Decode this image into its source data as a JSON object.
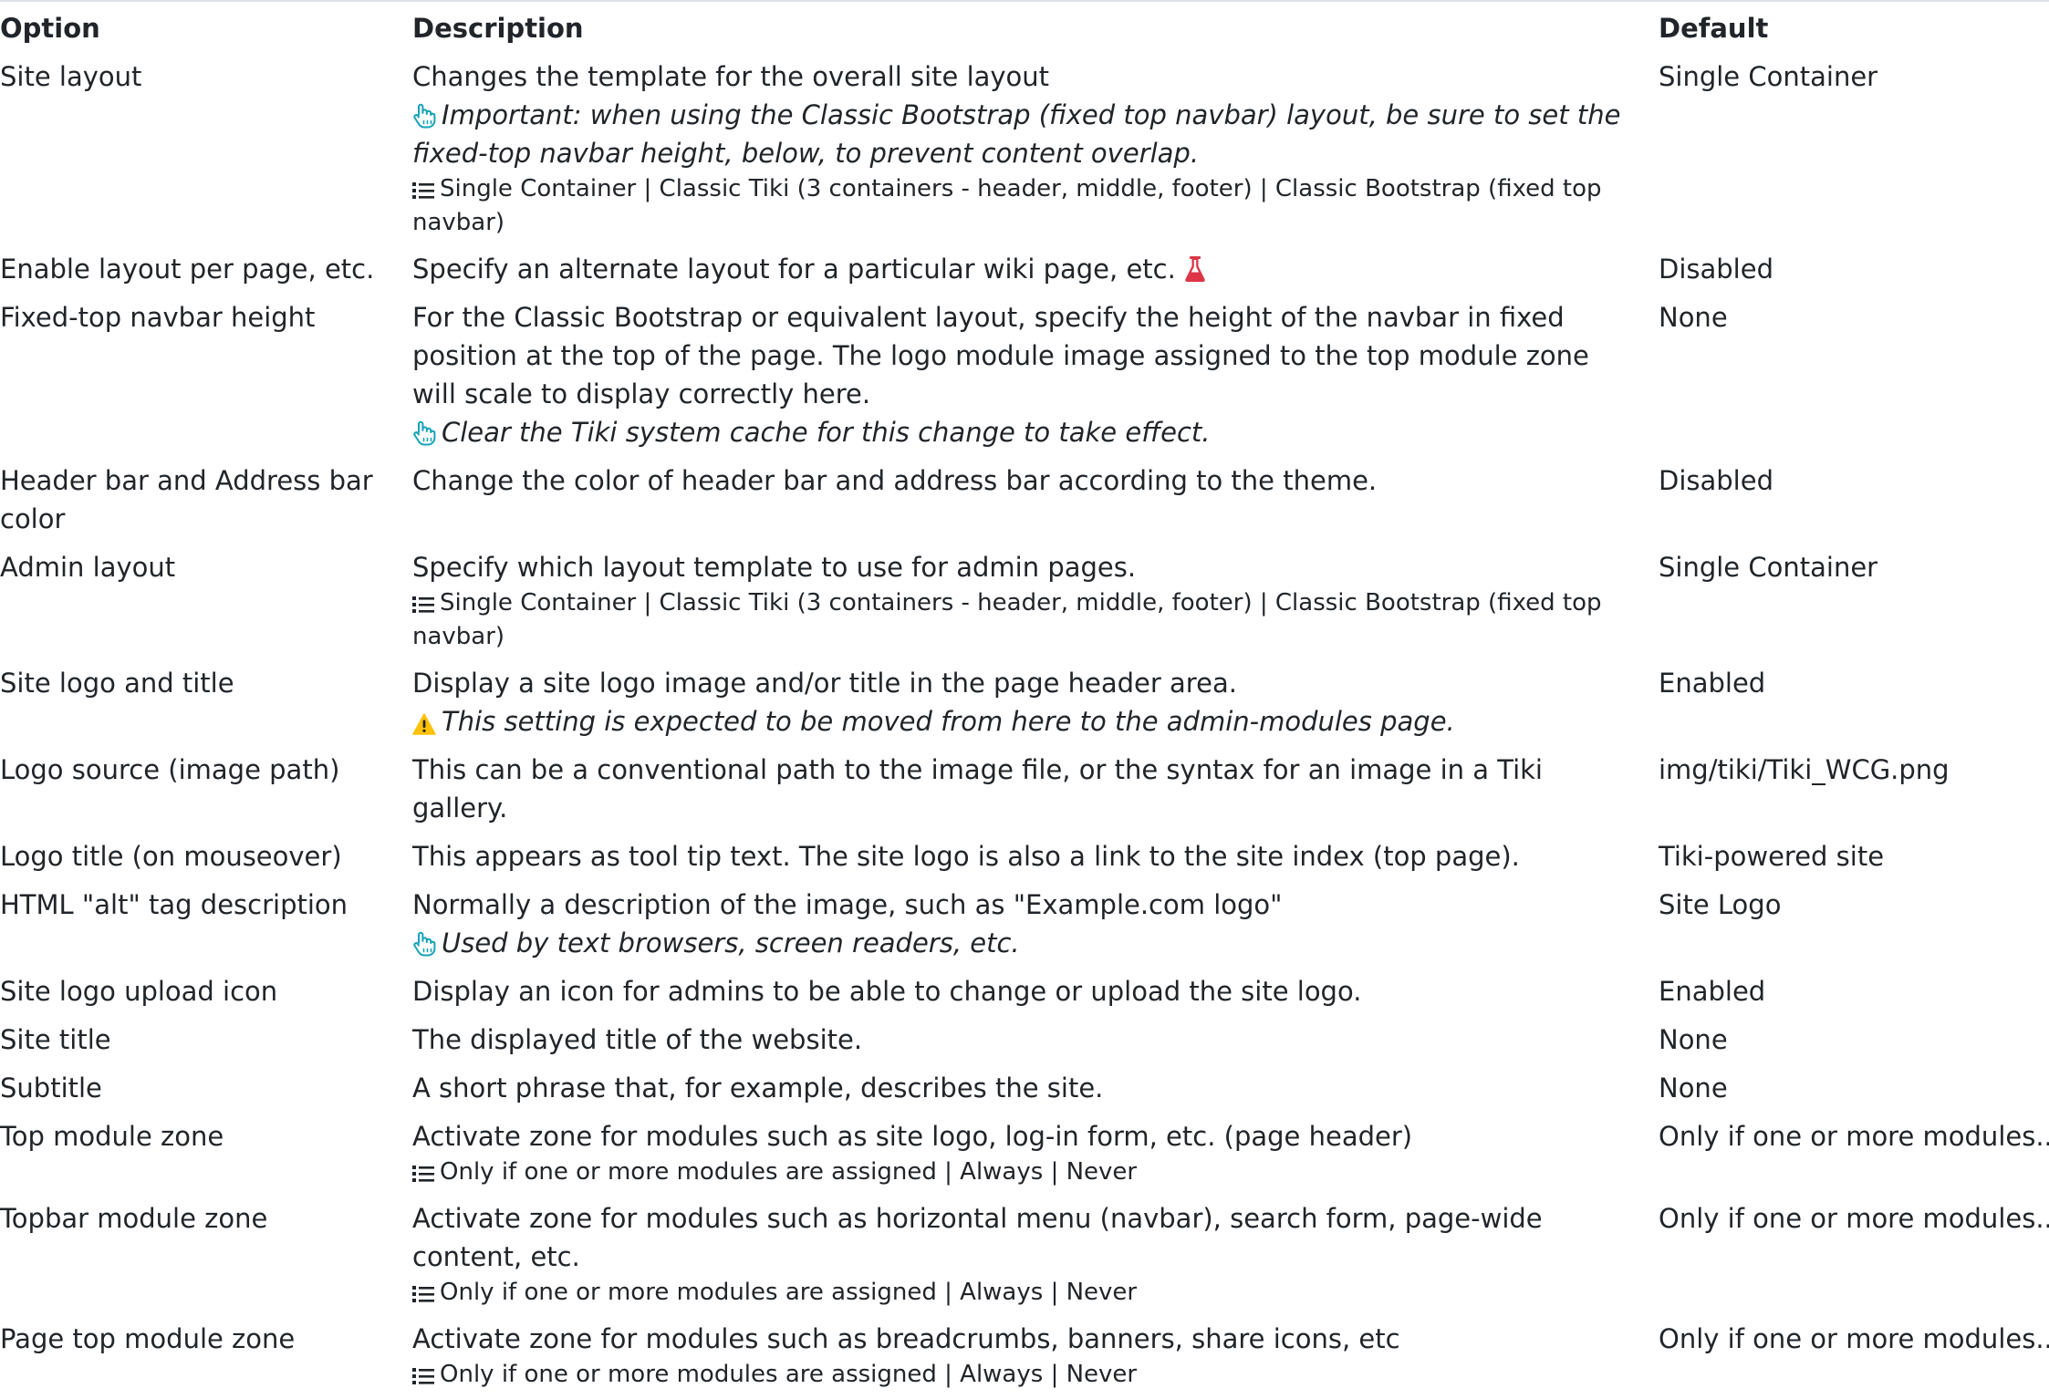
{
  "headers": {
    "option": "Option",
    "description": "Description",
    "default": "Default"
  },
  "icons": {
    "hint": "pointing-hand-icon",
    "list": "list-icon",
    "experimental": "flask-icon",
    "warning": "warning-icon"
  },
  "colors": {
    "hint_icon": "#17a2b8",
    "experimental_icon": "#dc3545",
    "warning_icon": "#ffc107",
    "text": "#212529"
  },
  "rows": [
    {
      "option": "Site layout",
      "description": "Changes the template for the overall site layout",
      "hint": "Important: when using the Classic Bootstrap (fixed top navbar) layout, be sure to set the fixed-top navbar height, below, to prevent content overlap.",
      "options": "Single Container | Classic Tiki (3 containers - header, middle, footer) | Classic Bootstrap (fixed top navbar)",
      "default": "Single Container"
    },
    {
      "option": "Enable layout per page, etc.",
      "description": "Specify an alternate layout for a particular wiki page, etc.",
      "default": "Disabled"
    },
    {
      "option": "Fixed-top navbar height",
      "description": "For the Classic Bootstrap or equivalent layout, specify the height of the navbar in fixed position at the top of the page. The logo module image assigned to the top module zone will scale to display correctly here.",
      "hint": "Clear the Tiki system cache for this change to take effect.",
      "default": "None"
    },
    {
      "option": "Header bar and Address bar color",
      "description": "Change the color of header bar and address bar according to the theme.",
      "default": "Disabled"
    },
    {
      "option": "Admin layout",
      "description": "Specify which layout template to use for admin pages.",
      "options": "Single Container | Classic Tiki (3 containers - header, middle, footer) | Classic Bootstrap (fixed top navbar)",
      "default": "Single Container"
    },
    {
      "option": "Site logo and title",
      "description": "Display a site logo image and/or title in the page header area.",
      "warning": "This setting is expected to be moved from here to the admin-modules page.",
      "default": "Enabled"
    },
    {
      "option": "Logo source (image path)",
      "description": "This can be a conventional path to the image file, or the syntax for an image in a Tiki gallery.",
      "default": "img/tiki/Tiki_WCG.png"
    },
    {
      "option": "Logo title (on mouseover)",
      "description": "This appears as tool tip text. The site logo is also a link to the site index (top page).",
      "default": "Tiki-powered site"
    },
    {
      "option": "HTML \"alt\" tag description",
      "description": "Normally a description of the image, such as \"Example.com logo\"",
      "hint": "Used by text browsers, screen readers, etc.",
      "default": "Site Logo"
    },
    {
      "option": "Site logo upload icon",
      "description": "Display an icon for admins to be able to change or upload the site logo.",
      "default": "Enabled"
    },
    {
      "option": "Site title",
      "description": "The displayed title of the website.",
      "default": "None"
    },
    {
      "option": "Subtitle",
      "description": "A short phrase that, for example, describes the site.",
      "default": "None"
    },
    {
      "option": "Top module zone",
      "description": "Activate zone for modules such as site logo, log-in form, etc. (page header)",
      "options": "Only if one or more modules are assigned | Always | Never",
      "default": "Only if one or more modules..."
    },
    {
      "option": "Topbar module zone",
      "description": "Activate zone for modules such as horizontal menu (navbar), search form, page-wide content, etc.",
      "options": "Only if one or more modules are assigned | Always | Never",
      "default": "Only if one or more modules..."
    },
    {
      "option": "Page top module zone",
      "description": "Activate zone for modules such as breadcrumbs, banners, share icons, etc",
      "options": "Only if one or more modules are assigned | Always | Never",
      "default": "Only if one or more modules..."
    }
  ]
}
